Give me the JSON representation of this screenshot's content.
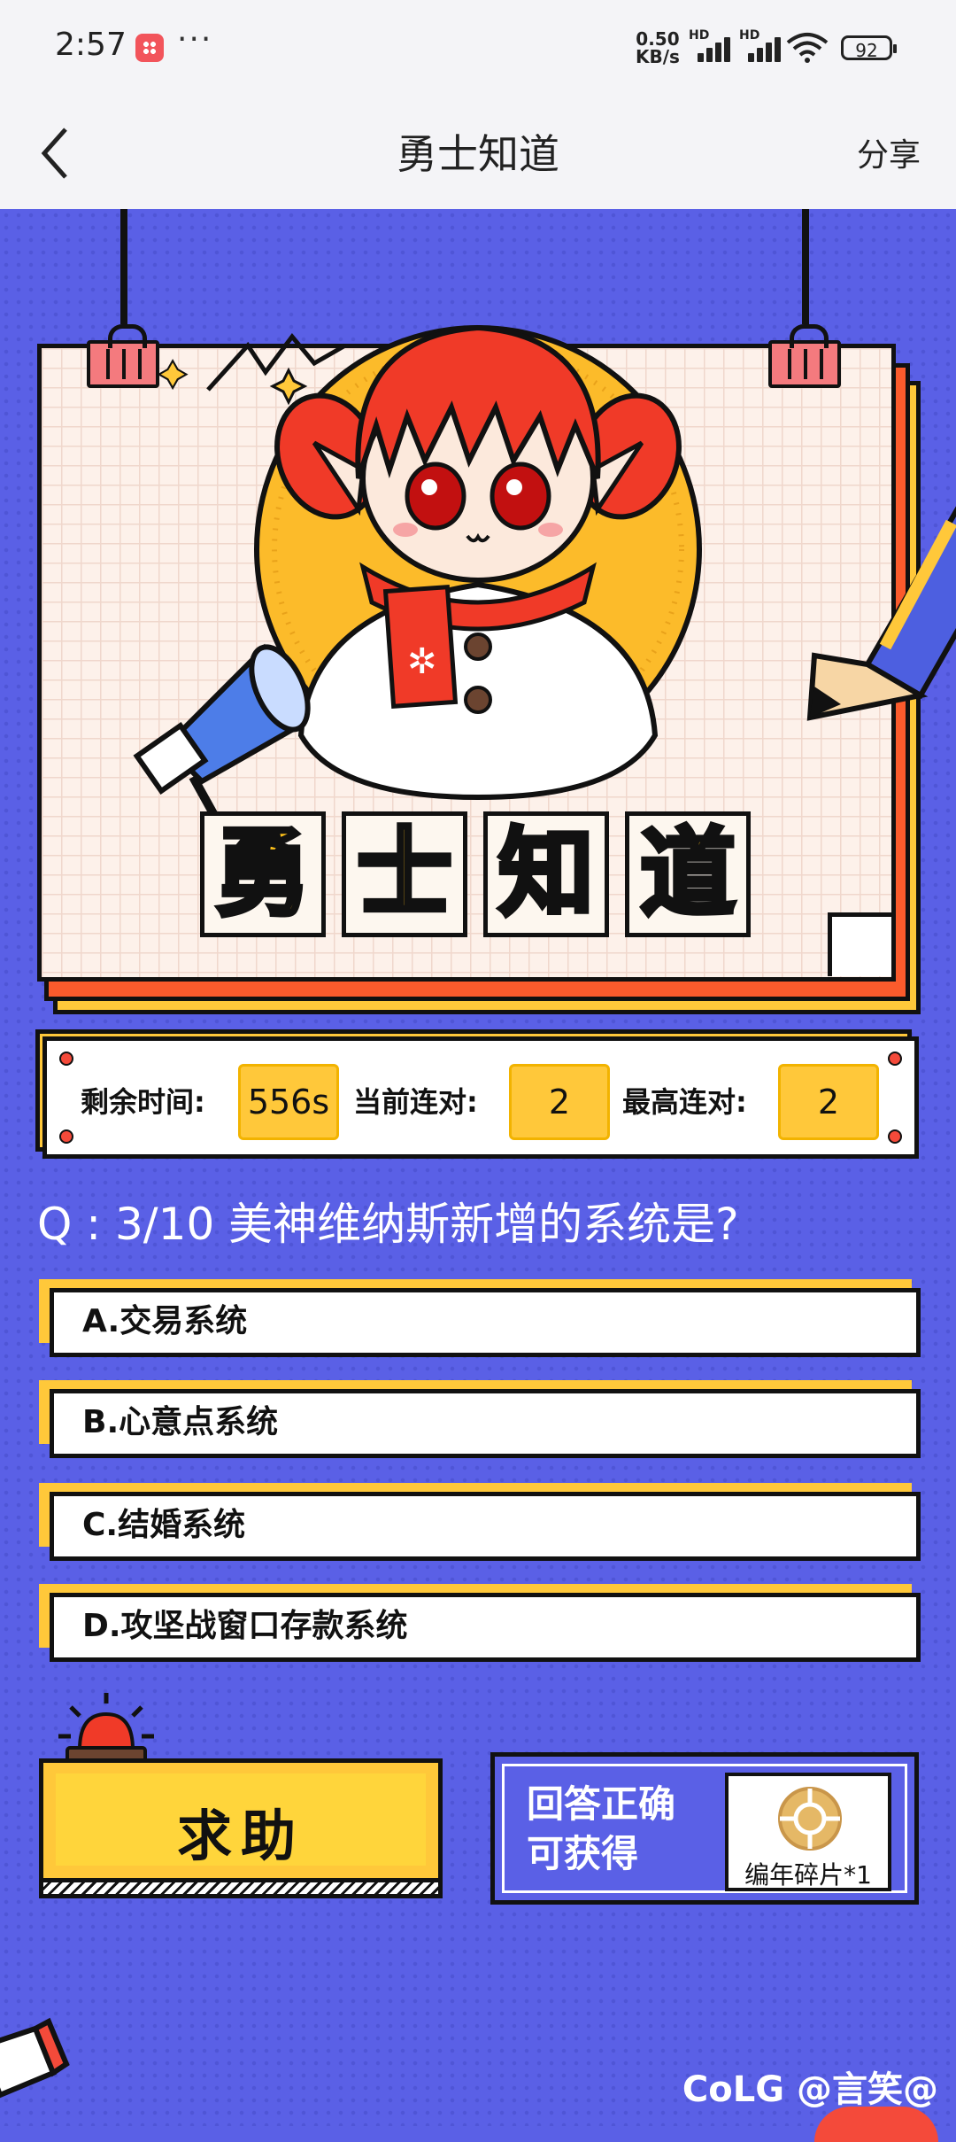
{
  "status_bar": {
    "time": "2:57",
    "more": "···",
    "network_speed_value": "0.50",
    "network_speed_unit": "KB/s",
    "signal1_tag": "HD",
    "signal2_tag": "HD",
    "battery": "92"
  },
  "nav": {
    "title": "勇士知道",
    "share": "分享"
  },
  "banner": {
    "chars": [
      "勇",
      "士",
      "知",
      "道"
    ]
  },
  "stats": {
    "time_label": "剩余时间:",
    "time_value": "556s",
    "streak_label": "当前连对:",
    "streak_value": "2",
    "best_label": "最高连对:",
    "best_value": "2"
  },
  "question": {
    "text": "Q : 3/10 美神维纳斯新增的系统是?"
  },
  "options": [
    {
      "label": "A.交易系统"
    },
    {
      "label": "B.心意点系统"
    },
    {
      "label": "C.结婚系统"
    },
    {
      "label": "D.攻坚战窗口存款系统"
    }
  ],
  "help_button": {
    "label": "求助"
  },
  "reward": {
    "line1": "回答正确",
    "line2": "可获得",
    "item_name": "编年碎片*1"
  },
  "watermark": "CoLG @言笑@",
  "colors": {
    "background": "#5a60e6",
    "accent_yellow": "#ffc83a",
    "accent_red": "#fb5b2c"
  }
}
